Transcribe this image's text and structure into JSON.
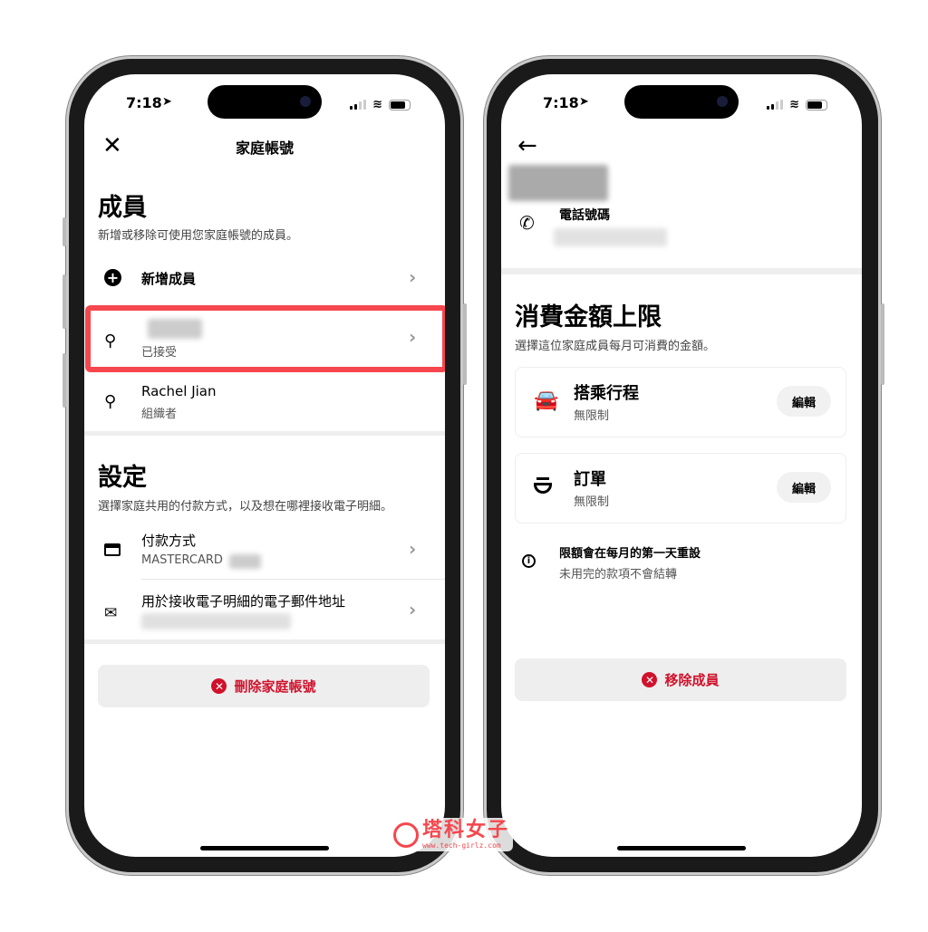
{
  "status_bar": {
    "time": "7:18"
  },
  "left": {
    "title": "家庭帳號",
    "members": {
      "heading": "成員",
      "subtitle": "新增或移除可使用您家庭帳號的成員。",
      "add_label": "新增成員",
      "items": [
        {
          "name": "",
          "status": "已接受",
          "highlighted": true
        },
        {
          "name": "Rachel Jian",
          "status": "組織者"
        }
      ]
    },
    "settings": {
      "heading": "設定",
      "subtitle": "選擇家庭共用的付款方式，以及想在哪裡接收電子明細。",
      "payment_label": "付款方式",
      "payment_value": "MASTERCARD",
      "email_label": "用於接收電子明細的電子郵件地址"
    },
    "delete_label": "刪除家庭帳號"
  },
  "right": {
    "phone_label": "電話號碼",
    "limits": {
      "heading": "消費金額上限",
      "subtitle": "選擇這位家庭成員每月可消費的金額。",
      "items": [
        {
          "title": "搭乘行程",
          "value": "無限制",
          "edit": "編輯",
          "icon": "car-icon"
        },
        {
          "title": "訂單",
          "value": "無限制",
          "edit": "編輯",
          "icon": "food-bowl-icon"
        }
      ]
    },
    "info_title": "限額會在每月的第一天重設",
    "info_sub": "未用完的款項不會結轉",
    "remove_label": "移除成員"
  },
  "watermark": {
    "text": "塔科女子",
    "url_text": "www.tech-girlz.com"
  },
  "colors": {
    "danger": "#d0112b",
    "highlight": "#f5474d"
  }
}
